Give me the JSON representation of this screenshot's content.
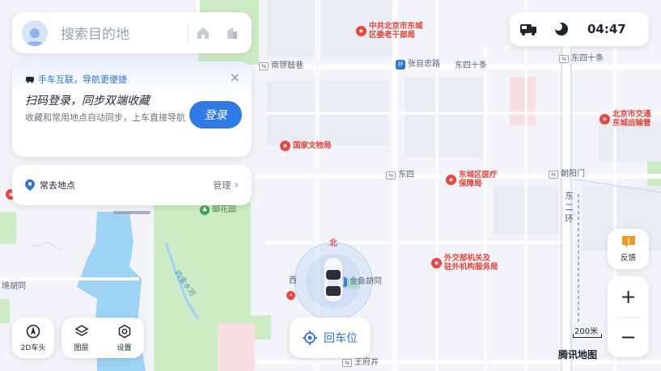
{
  "search": {
    "placeholder": "搜索目的地"
  },
  "status": {
    "time": "04:47"
  },
  "login_card": {
    "header": "手车互联，导航更便捷",
    "title": "扫码登录，同步双端收藏",
    "description": "收藏和常用地点自动同步，上车直接导航",
    "button": "登录",
    "close_symbol": "×"
  },
  "favorites": {
    "label": "常去地点",
    "manage": "管理",
    "chevron": "›"
  },
  "tools": {
    "view_mode": "2D车头",
    "layers": "图层",
    "settings": "设置"
  },
  "return_button": {
    "label": "回车位"
  },
  "feedback": {
    "label": "反馈"
  },
  "zoom": {
    "in": "+",
    "out": "−"
  },
  "scale": {
    "label": "200米"
  },
  "brand": "腾讯地图",
  "compass": {
    "north": "北"
  },
  "map_labels": {
    "nanluoguxiang": "南锣鼓巷",
    "zhangzizhonglu": "张自忠路",
    "dongsishitiao_1": "东四十条",
    "dongsishitiao_2": "东四十条",
    "dongsi": "东四",
    "chaoyangmen": "朝阳门",
    "donghuan": "东\n二\n环",
    "yuhuayuan": "御花园",
    "jinyudongtong": "金鱼胡同",
    "xi": "西",
    "wangfujing": "王府井",
    "jinghutong": "境胡同",
    "neijinshuihe": "内金水河"
  },
  "pois": {
    "party_committee": "中共北京市东城\n区委老干部局",
    "cultural_relics": "国家文物局",
    "transport_bureau": "北京市交通\n东城运输管",
    "medical_security": "东城区医疗\n保障局",
    "foreign_service": "外交部机关及\n驻外机构服务局"
  },
  "colors": {
    "accent": "#2f7ae5",
    "poi": "#e8463e",
    "park": "#cdebc4",
    "water": "#9fd3f5"
  }
}
